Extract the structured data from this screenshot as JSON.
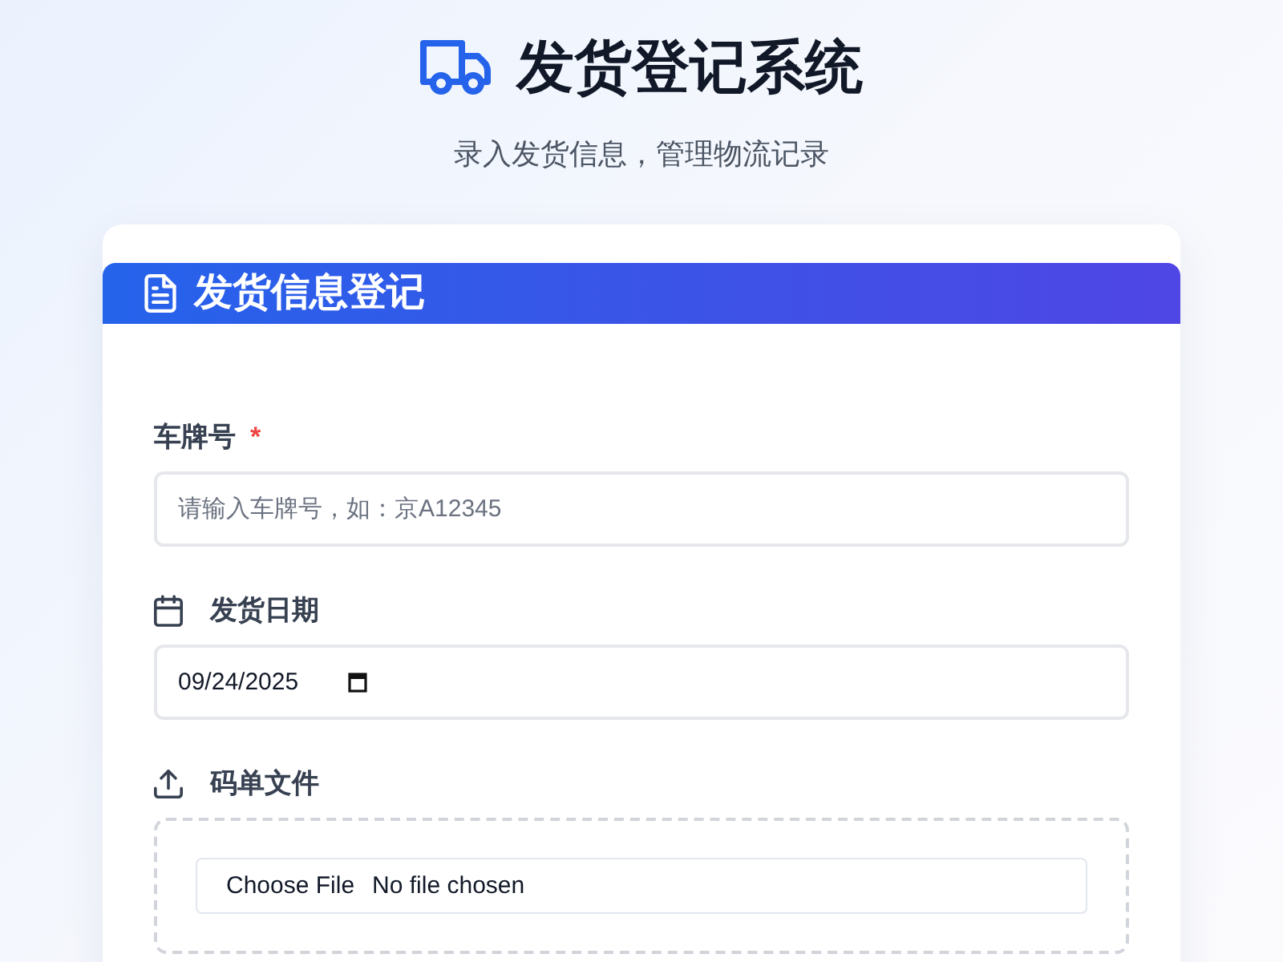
{
  "header": {
    "title": "发货登记系统",
    "subtitle": "录入发货信息，管理物流记录"
  },
  "form_card": {
    "title": "发货信息登记",
    "fields": [
      {
        "kind": "text",
        "label": "车牌号",
        "required_mark": "*",
        "placeholder": "请输入车牌号，如：京A12345"
      },
      {
        "kind": "date",
        "label": "发货日期",
        "value": "09/24/2025"
      },
      {
        "kind": "file",
        "label": "码单文件",
        "button": "Choose File",
        "status": "No file chosen"
      }
    ]
  }
}
